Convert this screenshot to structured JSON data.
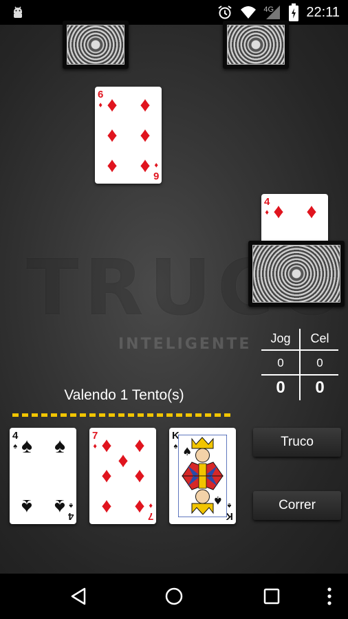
{
  "status_bar": {
    "time": "22:11",
    "network": "4G",
    "icons": [
      "android-icon",
      "alarm-icon",
      "wifi-icon",
      "signal-icon",
      "battery-icon"
    ]
  },
  "watermark": {
    "title": "TRUCO",
    "subtitle": "INTELIGENTE"
  },
  "played_cards": {
    "opponent_card": {
      "rank": "6",
      "suit": "♦",
      "color": "red"
    },
    "partner_card": {
      "rank": "4",
      "suit": "♦",
      "color": "red"
    }
  },
  "score": {
    "headers": [
      "Jog",
      "Cel"
    ],
    "round": [
      "0",
      "0"
    ],
    "total": [
      "0",
      "0"
    ]
  },
  "stake_text": "Valendo 1 Tento(s)",
  "hand": [
    {
      "rank": "4",
      "suit": "♠",
      "color": "black"
    },
    {
      "rank": "7",
      "suit": "♦",
      "color": "red"
    },
    {
      "rank": "K",
      "suit": "♠",
      "color": "black"
    }
  ],
  "buttons": {
    "truco": "Truco",
    "correr": "Correr"
  },
  "colors": {
    "red_suit": "#e0141e",
    "dash_line": "#f2c500"
  }
}
